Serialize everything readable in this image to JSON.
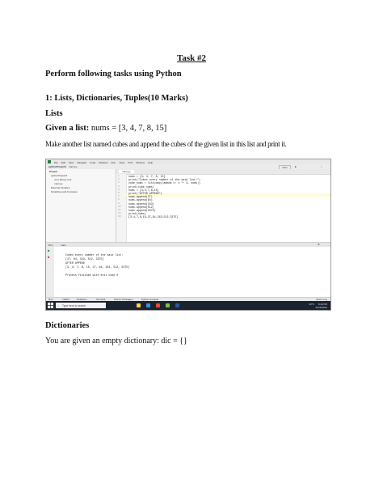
{
  "document": {
    "task_title": "Task #2",
    "intro": "Perform  following  tasks using Python",
    "section_heading": "1: Lists, Dictionaries, Tuples(10 Marks)",
    "lists_heading": "Lists",
    "given_label": "Given a list:",
    "given_code": " nums = [3, 4, 7, 8, 15]",
    "instruction": "Make another list named cubes and append the cubes of the given list in this list and print it.",
    "dict_heading": "Dictionaries",
    "dict_line": "You are given an empty dictionary: dic = {}"
  },
  "ide": {
    "menu": [
      "File",
      "Edit",
      "View",
      "Navigate",
      "Code",
      "Refactor",
      "Run",
      "Tools",
      "VCS",
      "Window",
      "Help"
    ],
    "project_title": "pythonProject4",
    "file_tab": "main.py",
    "run_config": "main",
    "sidebar": {
      "header": "Project",
      "root": "pythonProject4",
      "venv": "venv  library root",
      "main": "main.py",
      "external": "External Libraries",
      "scratches": "Scratches and Consoles"
    },
    "code_lines": [
      "nums = [3, 4, 7, 8, 15]",
      "print(\"Cubes every number of the said list:\")",
      "cube_nums = list(map(lambda x: x ** 3, nums))",
      "print(cube_nums)",
      "nums = [3,4,7,8,15]",
      "print(\"AFTER APPEND\")",
      "nums.append(27)",
      "nums.append(64)",
      "nums.append(343)",
      "nums.append(512)",
      "nums.append(3375)",
      "print(nums)",
      "[3,4,7,8,15,27,64,343,512,3375]"
    ],
    "run_tab": "main",
    "output_lines": [
      "Cubes every number of the said list:",
      "[27, 64, 343, 512, 3375]",
      "AFTER APPEND",
      "[3, 4, 7, 8, 15, 27, 64, 343, 512, 3375]",
      "",
      "Process finished with exit code 0"
    ],
    "bottom_tabs": [
      "Run",
      "TODO",
      "Problems",
      "Terminal",
      "Python Packages",
      "Python Console"
    ],
    "event_log": "Event Log",
    "status_right": "12:22  LF  UTF-8  4 spaces  Python 3.10 (pythonProject4)",
    "taskbar": {
      "search_placeholder": "Type here to search",
      "weather": "30°C",
      "time": "8:49 PM",
      "date": "11/26/2022"
    }
  },
  "colors": {
    "taskbar_bg": "#1b2330",
    "editor_bg": "#ffffff",
    "selection_line": "#fffbd6"
  }
}
